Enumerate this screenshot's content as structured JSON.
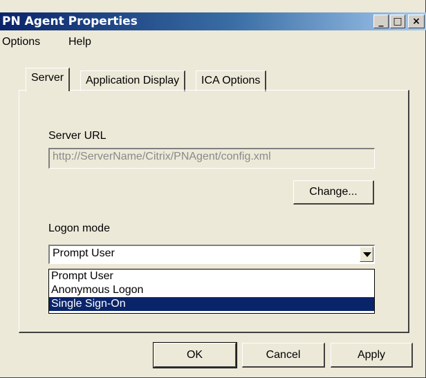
{
  "window": {
    "title": "PN Agent Properties"
  },
  "titlebar_buttons": {
    "minimize": "_",
    "maximize": "□",
    "close": "×"
  },
  "menu": {
    "options": "Options",
    "help": "Help"
  },
  "tabs": [
    {
      "label": "Server",
      "active": true
    },
    {
      "label": "Application Display",
      "active": false
    },
    {
      "label": "ICA Options",
      "active": false
    }
  ],
  "server": {
    "url_label": "Server URL",
    "url_value": "http://ServerName/Citrix/PNAgent/config.xml",
    "change_button": "Change..."
  },
  "logon": {
    "label": "Logon mode",
    "selected": "Prompt User",
    "options": [
      "Prompt User",
      "Anonymous Logon",
      "Single Sign-On"
    ],
    "highlighted": "Single Sign-On"
  },
  "buttons": {
    "ok": "OK",
    "cancel": "Cancel",
    "apply": "Apply"
  },
  "colors": {
    "titlebar_start": "#0a246a",
    "selection": "#0a246a",
    "face": "#ece9d8"
  }
}
